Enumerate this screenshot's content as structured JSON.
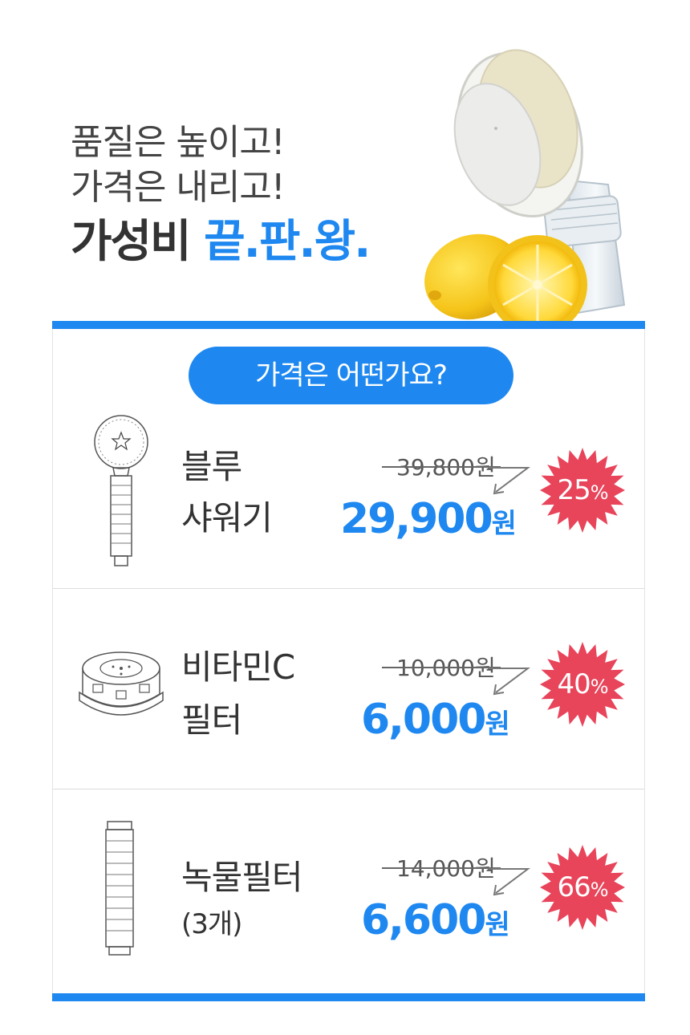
{
  "headline": {
    "line1": "품질은 높이고!",
    "line2": "가격은 내리고!",
    "line3_prefix": "가성비 ",
    "line3_accent": "끝.판.왕."
  },
  "section_title": "가격은 어떤가요?",
  "colors": {
    "accent": "#1e88f0",
    "badge": "#e8445a",
    "text": "#333333"
  },
  "products": [
    {
      "name_line1": "블루",
      "name_line2": "샤워기",
      "original_price": "39,800원",
      "sale_price_number": "29,900",
      "sale_price_unit": "원",
      "discount_number": "25",
      "discount_symbol": "%",
      "icon": "shower-head-icon"
    },
    {
      "name_line1": "비타민C",
      "name_line2": "필터",
      "original_price": "10,000원",
      "sale_price_number": "6,000",
      "sale_price_unit": "원",
      "discount_number": "40",
      "discount_symbol": "%",
      "icon": "vitamin-c-filter-icon"
    },
    {
      "name_line1": "녹물필터",
      "name_line2": "(3개)",
      "original_price": "14,000원",
      "sale_price_number": "6,600",
      "sale_price_unit": "원",
      "discount_number": "66",
      "discount_symbol": "%",
      "icon": "rust-filter-cartridge-icon"
    }
  ]
}
